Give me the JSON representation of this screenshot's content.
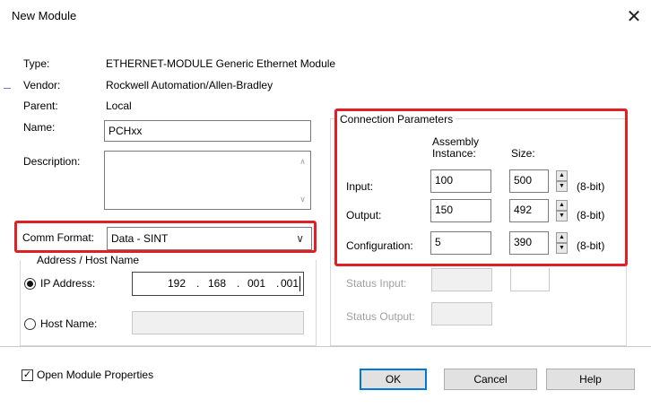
{
  "dialog": {
    "title": "New Module",
    "close_glyph": "✕"
  },
  "module": {
    "type_label": "Type:",
    "type_value": "ETHERNET-MODULE Generic Ethernet Module",
    "vendor_label": "Vendor:",
    "vendor_value": "Rockwell Automation/Allen-Bradley",
    "parent_label": "Parent:",
    "parent_value": "Local",
    "name_label": "Name:",
    "name_value": "PCHxx",
    "description_label": "Description:",
    "description_value": ""
  },
  "comm_format": {
    "label": "Comm Format:",
    "value": "Data - SINT"
  },
  "address": {
    "group_title": "Address / Host Name",
    "ip_label": "IP Address:",
    "ip_octets": [
      "192",
      "168",
      "001",
      "001"
    ],
    "ip_dot": ".",
    "host_label": "Host Name:",
    "host_value": "",
    "selected": "ip"
  },
  "connection": {
    "group_title": "Connection Parameters",
    "assembly_header_line1": "Assembly",
    "assembly_header_line2": "Instance:",
    "size_header": "Size:",
    "unit": "(8-bit)",
    "rows": [
      {
        "label": "Input:",
        "instance": "100",
        "size": "500"
      },
      {
        "label": "Output:",
        "instance": "150",
        "size": "492"
      },
      {
        "label": "Configuration:",
        "instance": "5",
        "size": "390"
      }
    ],
    "status_input_label": "Status Input:",
    "status_output_label": "Status Output:"
  },
  "footer": {
    "open_props_label": "Open Module Properties",
    "open_props_checked": true,
    "check_glyph": "✓",
    "ok_label": "OK",
    "cancel_label": "Cancel",
    "help_label": "Help"
  },
  "colors": {
    "highlight": "#e31f26",
    "focus": "#0078d7"
  }
}
